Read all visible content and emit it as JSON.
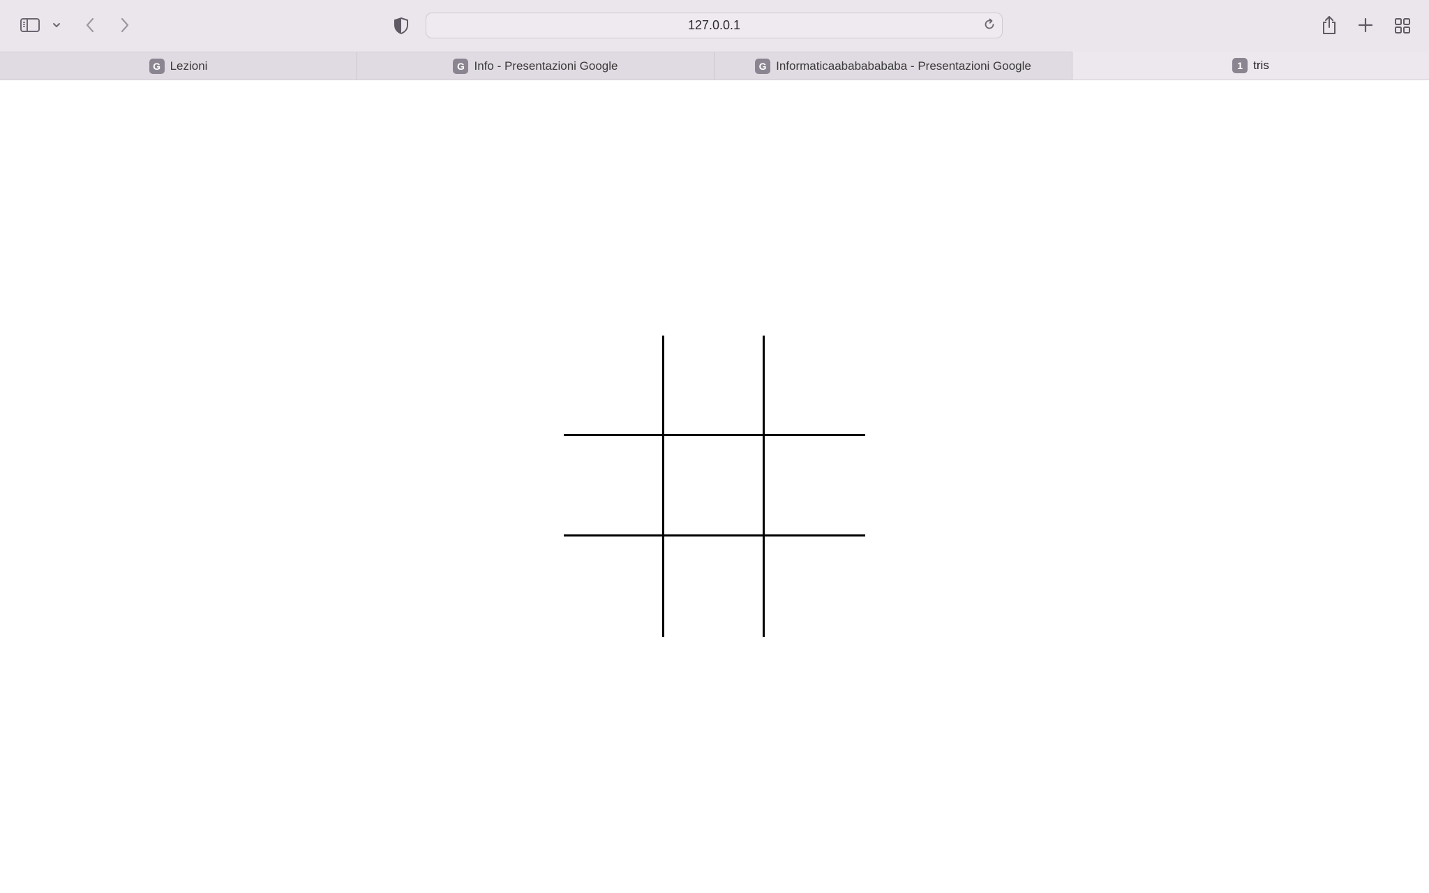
{
  "browser": {
    "address_bar": {
      "url": "127.0.0.1"
    },
    "toolbar_icons": {
      "sidebar": "sidebar-icon",
      "sidebar_menu": "chevron-down-icon",
      "back": "chevron-left-icon",
      "forward": "chevron-right-icon",
      "privacy": "shield-icon",
      "reload": "reload-icon",
      "share": "share-icon",
      "new_tab": "plus-icon",
      "tab_overview": "grid-icon"
    },
    "tabs": [
      {
        "favicon": "G",
        "label": "Lezioni",
        "active": false
      },
      {
        "favicon": "G",
        "label": "Info - Presentazioni Google",
        "active": false
      },
      {
        "favicon": "G",
        "label": "Informaticaabababababa - Presentazioni Google",
        "active": false
      },
      {
        "favicon": "1",
        "label": "tris",
        "active": true
      }
    ]
  },
  "game": {
    "board": [
      [
        "",
        "",
        ""
      ],
      [
        "",
        "",
        ""
      ],
      [
        "",
        "",
        ""
      ]
    ],
    "grid_color": "#000000"
  }
}
